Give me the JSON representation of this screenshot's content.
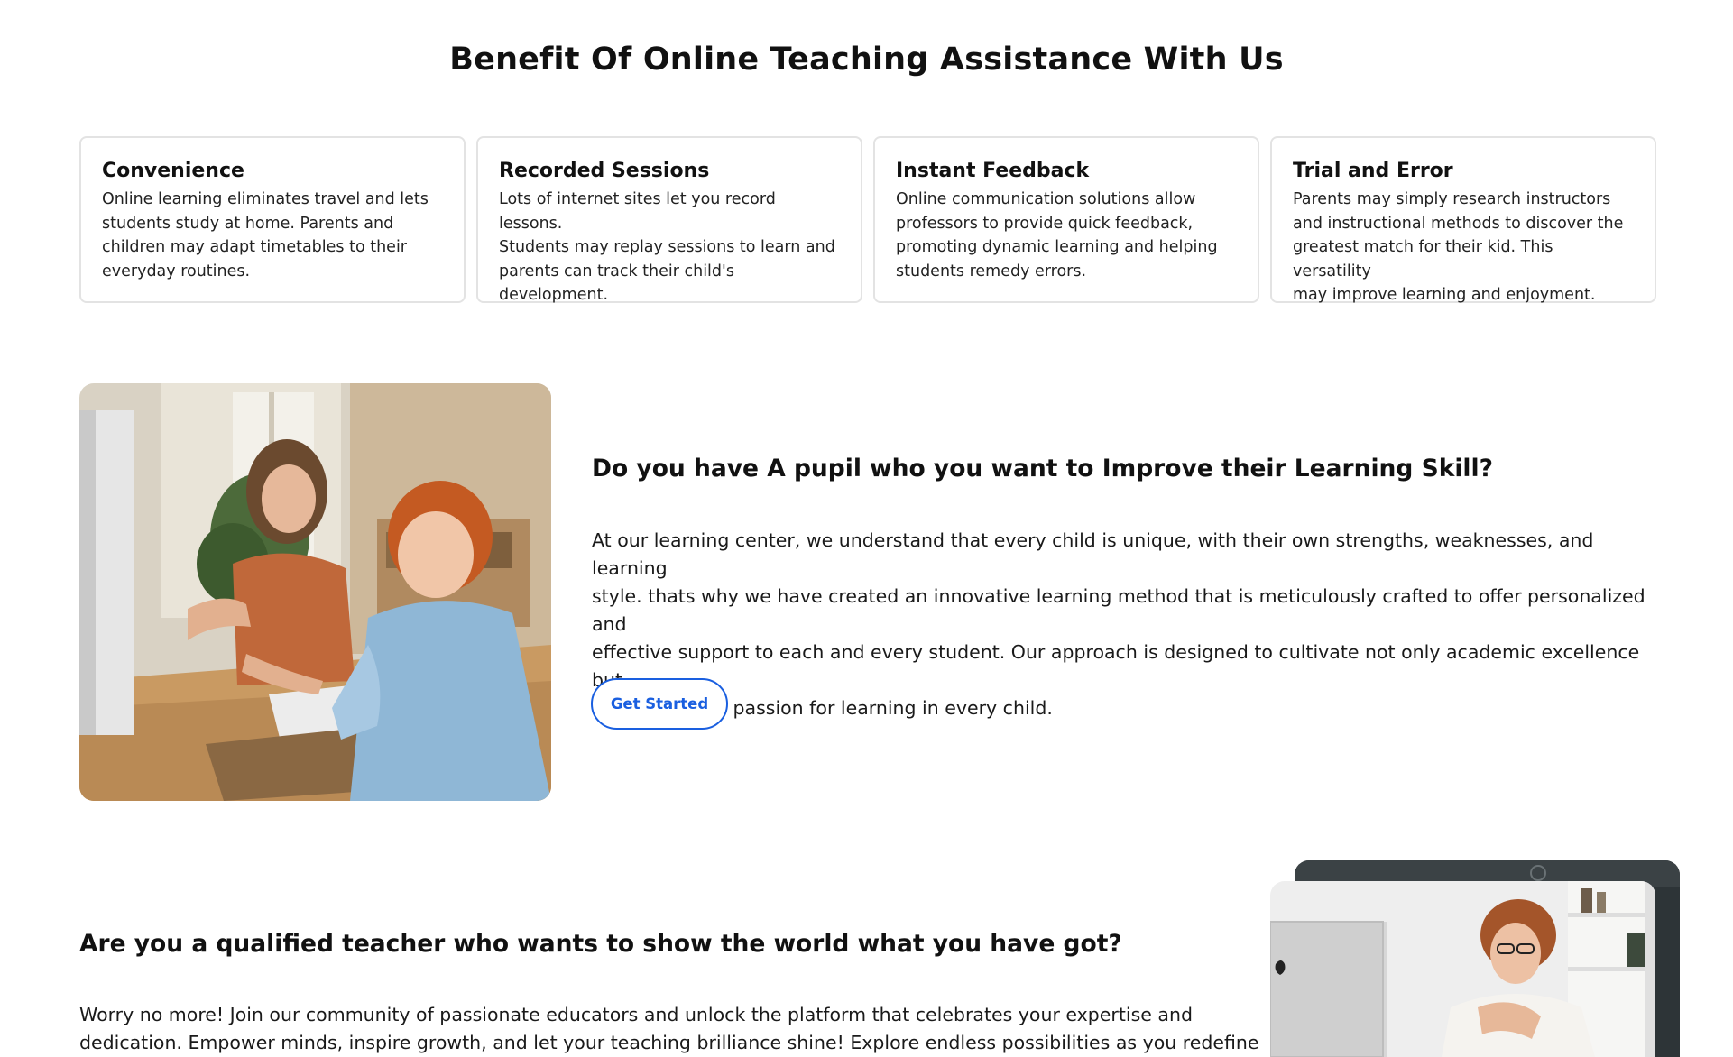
{
  "benefits": {
    "title": "Benefit Of Online Teaching Assistance With Us",
    "cards": [
      {
        "title": "Convenience",
        "text": "Online learning eliminates travel and lets\nstudents study at home. Parents and\nchildren may adapt timetables to their\neveryday routines."
      },
      {
        "title": "Recorded Sessions",
        "text": "Lots of internet sites let you record lessons.\nStudents may replay sessions to learn and\nparents can track their child's\ndevelopment."
      },
      {
        "title": "Instant Feedback",
        "text": "Online communication solutions allow\nprofessors to provide quick feedback,\npromoting dynamic learning and helping\nstudents remedy errors."
      },
      {
        "title": "Trial and Error",
        "text": "Parents may simply research instructors\nand instructional methods to discover the\ngreatest match for their kid. This versatility\nmay improve learning and enjoyment."
      }
    ]
  },
  "pupil_section": {
    "heading": "Do you have A pupil who you want to Improve their Learning Skill?",
    "text": "At our learning center, we understand that every child is unique, with their own strengths, weaknesses, and learning\nstyle. thats why we have created an innovative learning method that is meticulously crafted to offer personalized and\neffective support to each and every student. Our approach is designed to cultivate not only academic excellence but\nalso a genuine passion for learning in every child.",
    "button_label": "Get Started"
  },
  "teacher_section": {
    "heading": "Are you a qualified teacher who wants to show the world what you have got?",
    "text": "Worry no more! Join our community of passionate educators and unlock the platform that celebrates your expertise and\ndedication. Empower minds, inspire growth, and let your teaching brilliance shine! Explore endless possibilities as you redefine"
  },
  "colors": {
    "accent": "#1a5fe0",
    "card_border": "#e3e3e3",
    "text": "#111111"
  }
}
